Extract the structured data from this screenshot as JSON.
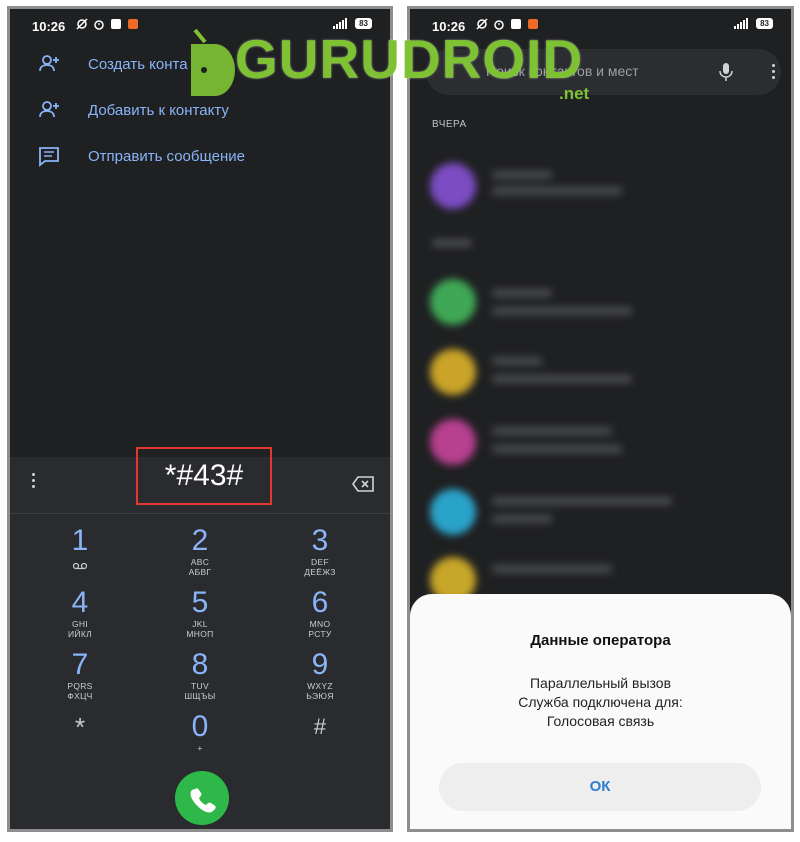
{
  "status": {
    "time": "10:26",
    "battery": "83"
  },
  "left": {
    "menu": [
      {
        "label": "Создать конта",
        "icon": "person-add-icon"
      },
      {
        "label": "Добавить к контакту",
        "icon": "person-add-icon"
      },
      {
        "label": "Отправить сообщение",
        "icon": "message-icon"
      }
    ],
    "dialed": "*#43#",
    "keys": [
      {
        "num": "1",
        "sub": ""
      },
      {
        "num": "2",
        "sub": "ABC",
        "sub2": "АБВГ"
      },
      {
        "num": "3",
        "sub": "DEF",
        "sub2": "ДЕЁЖЗ"
      },
      {
        "num": "4",
        "sub": "GHI",
        "sub2": "ИЙКЛ"
      },
      {
        "num": "5",
        "sub": "JKL",
        "sub2": "МНОП"
      },
      {
        "num": "6",
        "sub": "MNO",
        "sub2": "РСТУ"
      },
      {
        "num": "7",
        "sub": "PQRS",
        "sub2": "ФХЦЧ"
      },
      {
        "num": "8",
        "sub": "TUV",
        "sub2": "ШЩЪЫ"
      },
      {
        "num": "9",
        "sub": "WXYZ",
        "sub2": "ЬЭЮЯ"
      },
      {
        "num": "*",
        "sub": ""
      },
      {
        "num": "0",
        "sub": "+"
      },
      {
        "num": "#",
        "sub": ""
      }
    ]
  },
  "right": {
    "search_placeholder": "Поиск контактов и мест",
    "section_label": "ВЧЕРА",
    "dialog": {
      "title": "Данные оператора",
      "line1": "Параллельный вызов",
      "line2": "Служба подключена для:",
      "line3": "Голосовая связь",
      "ok_label": "ОК"
    },
    "avatar_colors": [
      "#7b4cc2",
      "#3fa856",
      "#c9a429",
      "#b7408f",
      "#2aa3c9",
      "#c7a628"
    ]
  },
  "watermark": {
    "text": "GURUDROID",
    "suffix": ".net"
  },
  "colors": {
    "accent": "#8ab4f8",
    "call": "#2eb84a",
    "highlight": "#e03a2f",
    "brand": "#7ec234"
  }
}
